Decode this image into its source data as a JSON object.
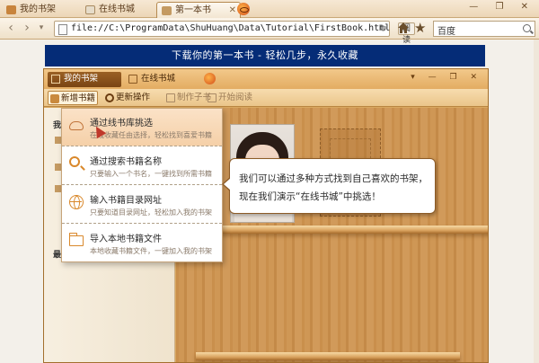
{
  "browser": {
    "tabs": [
      {
        "label": "我的书架"
      },
      {
        "label": "在线书城"
      },
      {
        "label": "第一本书"
      }
    ],
    "address": "file://C:\\ProgramData\\ShuHuang\\Data\\Tutorial\\FirstBook.html",
    "reader_label": "阅读器",
    "search_value": "百度"
  },
  "page": {
    "banner": "下载你的第一本书 - 轻松几步，永久收藏"
  },
  "app": {
    "tabs": [
      {
        "label": "我的书架"
      },
      {
        "label": "在线书城"
      }
    ],
    "toolbar": {
      "new_book": "新增书籍",
      "more": "更新操作",
      "make": "制作子书",
      "read": "开始阅读"
    },
    "left_labels": [
      "我",
      "最"
    ],
    "menu": [
      {
        "title": "通过线书库挑选",
        "desc": "在线收藏任由选择，轻松找到喜爱书籍"
      },
      {
        "title": "通过搜索书籍名称",
        "desc": "只要输入一个书名，一键找到所需书籍"
      },
      {
        "title": "输入书籍目录网址",
        "desc": "只要知道目录网址，轻松加入我的书架"
      },
      {
        "title": "导入本地书籍文件",
        "desc": "本地收藏书籍文件，一键加入我的书架"
      }
    ],
    "bubble": {
      "line1": "我们可以通过多种方式找到自己喜欢的书架，",
      "line2": "现在我们演示“在线书城”中挑选！"
    }
  },
  "colors": {
    "banner_bg": "#052c77",
    "wood": "#d9a860",
    "accent": "#d9882b"
  }
}
